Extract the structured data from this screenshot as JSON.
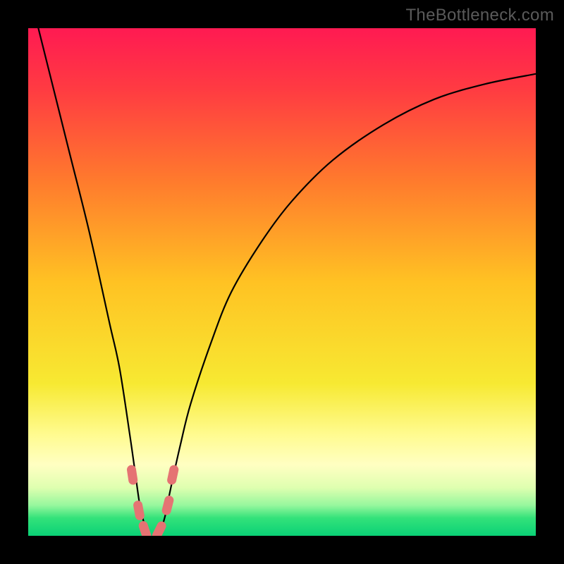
{
  "watermark": "TheBottleneck.com",
  "chart_data": {
    "type": "line",
    "title": "",
    "xlabel": "",
    "ylabel": "",
    "xlim": [
      0,
      100
    ],
    "ylim": [
      0,
      100
    ],
    "background": {
      "type": "vertical-gradient",
      "stops": [
        {
          "pos": 0.0,
          "color": "#ff1a52"
        },
        {
          "pos": 0.12,
          "color": "#ff3b42"
        },
        {
          "pos": 0.3,
          "color": "#ff7a2d"
        },
        {
          "pos": 0.5,
          "color": "#ffc223"
        },
        {
          "pos": 0.7,
          "color": "#f7e932"
        },
        {
          "pos": 0.8,
          "color": "#fffb8f"
        },
        {
          "pos": 0.86,
          "color": "#ffffc2"
        },
        {
          "pos": 0.905,
          "color": "#dfffb0"
        },
        {
          "pos": 0.94,
          "color": "#96f79d"
        },
        {
          "pos": 0.965,
          "color": "#33e27a"
        },
        {
          "pos": 1.0,
          "color": "#0ad176"
        }
      ]
    },
    "series": [
      {
        "name": "bottleneck-curve",
        "note": "percent bottleneck vs normalized hardware capability; deep V with minimum near optimal balance point",
        "x": [
          0,
          4,
          8,
          12,
          16,
          18,
          20,
          21,
          22,
          23,
          24,
          25,
          26,
          27,
          28,
          30,
          32,
          36,
          40,
          46,
          52,
          60,
          70,
          80,
          90,
          100
        ],
        "y": [
          108,
          92,
          76,
          60,
          42,
          33,
          20,
          13,
          6,
          2,
          0,
          0,
          1,
          4,
          9,
          18,
          26,
          38,
          48,
          58,
          66,
          74,
          81,
          86,
          89,
          91
        ]
      }
    ],
    "markers": {
      "name": "near-bottom-dots",
      "color": "#e57373",
      "points": [
        {
          "x": 20.5,
          "y": 12
        },
        {
          "x": 21.8,
          "y": 5
        },
        {
          "x": 23.0,
          "y": 1
        },
        {
          "x": 25.8,
          "y": 1
        },
        {
          "x": 27.5,
          "y": 6
        },
        {
          "x": 28.5,
          "y": 12
        }
      ]
    }
  }
}
